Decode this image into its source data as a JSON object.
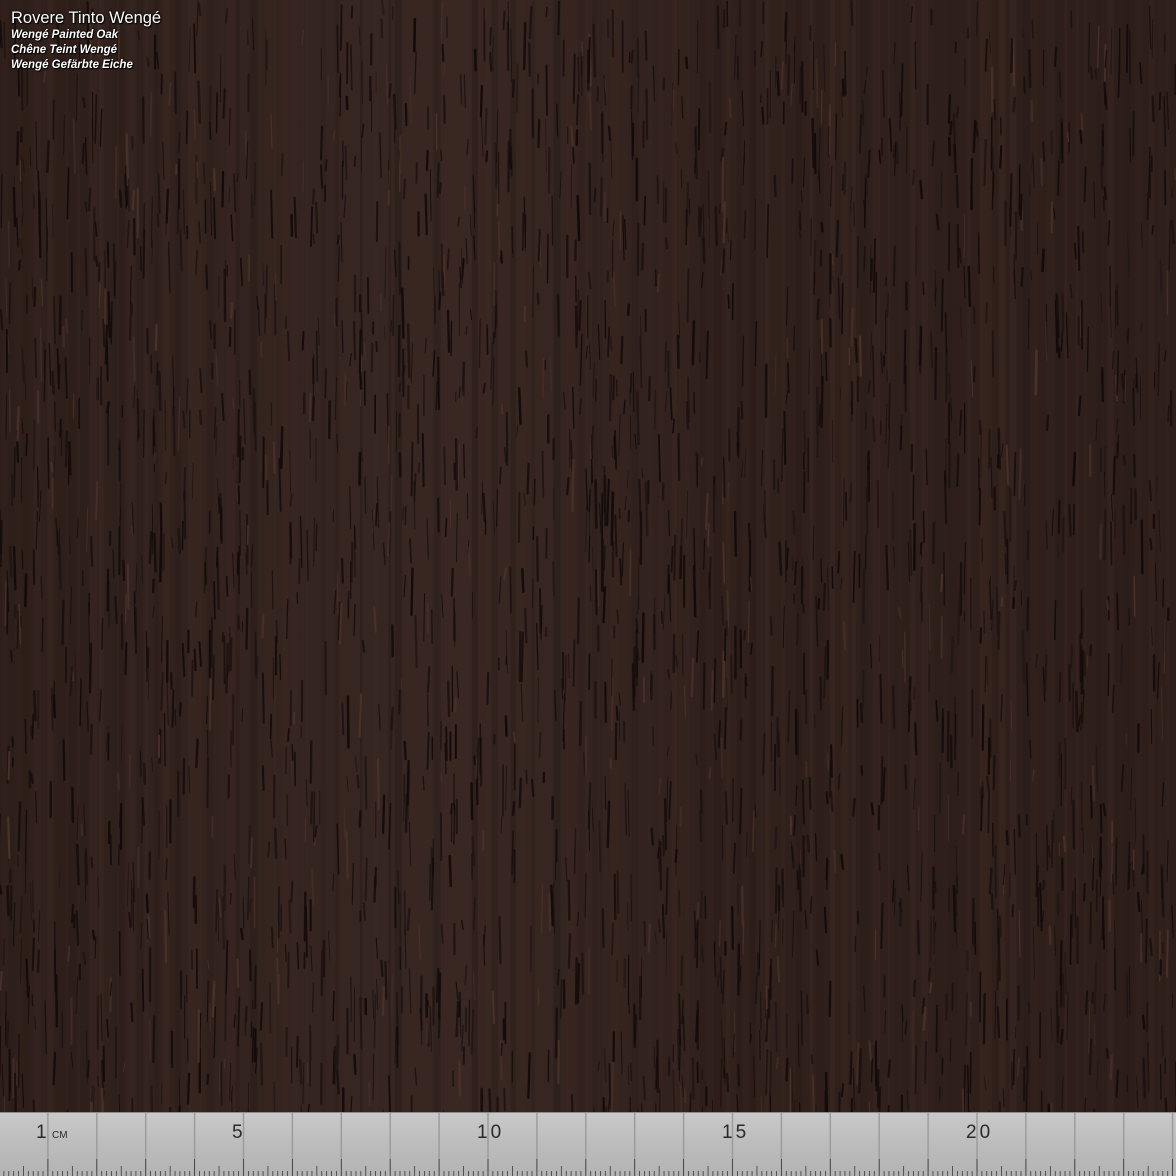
{
  "labels": {
    "title": "Rovere Tinto Wengé",
    "en": "Wengé Painted Oak",
    "fr": "Chêne Teint Wengé",
    "de": "Wengé Gefärbte Eiche"
  },
  "ruler": {
    "unit": "CM",
    "numbers": [
      "1",
      "5",
      "10",
      "15",
      "20"
    ]
  },
  "colors": {
    "wood_base": "#34231e",
    "grain_dark": "#120b09",
    "grain_mid": "#1e1411",
    "grain_light": "#4a322a",
    "ruler": "#bdbdbd"
  }
}
